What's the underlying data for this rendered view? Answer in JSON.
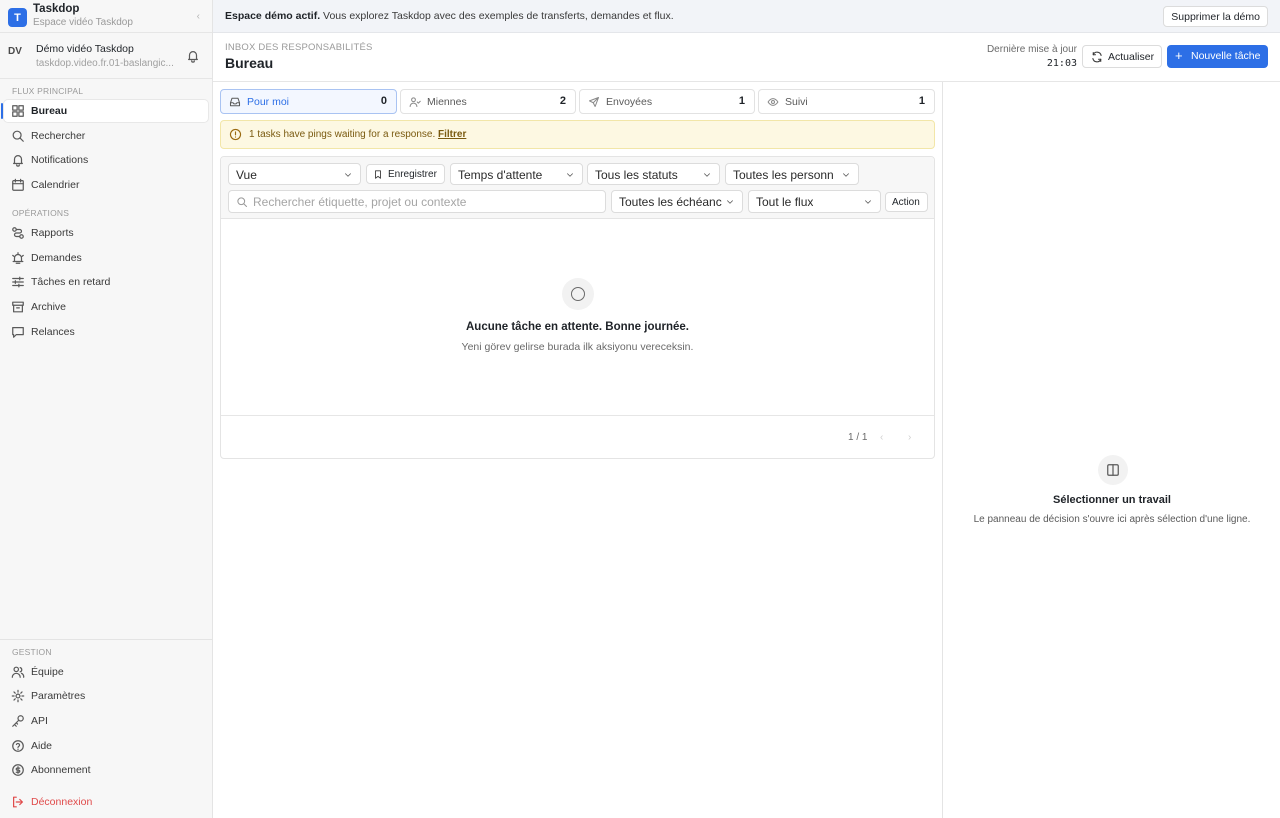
{
  "brand": {
    "logo_letter": "T",
    "name": "Taskdop",
    "subtitle": "Espace vidéo Taskdop",
    "collapse": "‹"
  },
  "user": {
    "initials": "DV",
    "name": "Démo vidéo Taskdop",
    "email": "taskdop.video.fr.01-baslangic..."
  },
  "sidebar": {
    "section_main": "FLUX PRINCIPAL",
    "main_items": [
      {
        "label": "Bureau",
        "icon": "grid-icon",
        "active": true
      },
      {
        "label": "Rechercher",
        "icon": "search-icon"
      },
      {
        "label": "Notifications",
        "icon": "bell-icon"
      },
      {
        "label": "Calendrier",
        "icon": "calendar-icon"
      }
    ],
    "section_ops": "OPÉRATIONS",
    "ops_items": [
      {
        "label": "Rapports",
        "icon": "route-icon"
      },
      {
        "label": "Demandes",
        "icon": "bell-ring-icon"
      },
      {
        "label": "Tâches en retard",
        "icon": "sliders-icon"
      },
      {
        "label": "Archive",
        "icon": "archive-icon"
      },
      {
        "label": "Relances",
        "icon": "message-icon"
      }
    ],
    "section_gestion": "GESTION",
    "gestion_items": [
      {
        "label": "Équipe",
        "icon": "users-icon"
      },
      {
        "label": "Paramètres",
        "icon": "gear-icon"
      },
      {
        "label": "API",
        "icon": "key-icon"
      },
      {
        "label": "Aide",
        "icon": "help-icon"
      },
      {
        "label": "Abonnement",
        "icon": "dollar-icon"
      }
    ],
    "logout": {
      "label": "Déconnexion",
      "icon": "logout-icon"
    }
  },
  "banner": {
    "bold": "Espace démo actif.",
    "text": " Vous explorez Taskdop avec des exemples de transferts, demandes et flux.",
    "button": "Supprimer la démo"
  },
  "header": {
    "eyebrow": "INBOX DES RESPONSABILITÉS",
    "title": "Bureau",
    "updated_label": "Dernière mise à jour",
    "updated_time": "21:03",
    "refresh": "Actualiser",
    "new_task": "Nouvelle tâche"
  },
  "tabs": [
    {
      "label": "Pour moi",
      "count": "0",
      "icon": "inbox-icon",
      "active": true
    },
    {
      "label": "Miennes",
      "count": "2",
      "icon": "user-check-icon"
    },
    {
      "label": "Envoyées",
      "count": "1",
      "icon": "send-icon"
    },
    {
      "label": "Suivi",
      "count": "1",
      "icon": "eye-icon"
    }
  ],
  "alert": {
    "text": "1 tasks have pings waiting for a response. ",
    "link": "Filtrer"
  },
  "filters": {
    "view": "Vue",
    "save": "Enregistrer",
    "wait": "Temps d'attente",
    "status": "Tous les statuts",
    "people": "Toutes les personn",
    "search_placeholder": "Rechercher étiquette, projet ou contexte",
    "deadline": "Toutes les échéanc",
    "flow": "Tout le flux",
    "action": "Action"
  },
  "empty": {
    "title": "Aucune tâche en attente. Bonne journée.",
    "subtitle": "Yeni görev gelirse burada ilk aksiyonu vereceksin."
  },
  "pager": {
    "text": "1 / 1",
    "prev": "‹",
    "next": "›"
  },
  "right_panel": {
    "title": "Sélectionner un travail",
    "subtitle": "Le panneau de décision s'ouvre ici après sélection d'une ligne."
  },
  "colors": {
    "accent": "#2d6fe6",
    "danger": "#e04a4a",
    "alert_bg": "#fdf8e2"
  }
}
